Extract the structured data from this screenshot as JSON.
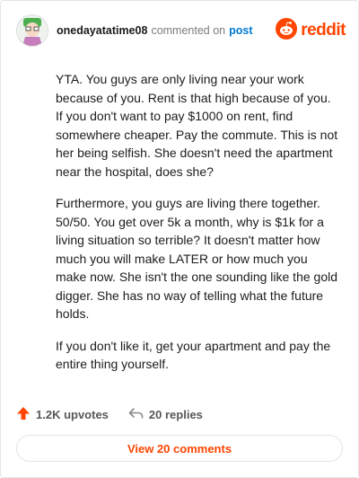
{
  "header": {
    "username": "onedayatatime08",
    "action_text": "commented on",
    "post_link": "post",
    "logo_text": "reddit"
  },
  "comment": {
    "paragraphs": [
      "YTA. You guys are only living near your work because of you. Rent is that high because of you. If you don't want to pay $1000 on rent, find somewhere cheaper. Pay the commute. This is not her being selfish. She doesn't need the apartment near the hospital, does she?",
      "Furthermore, you guys are living there together. 50/50. You get over 5k a month, why is $1k for a living situation so terrible? It doesn't matter how much you will make LATER or how much you make now. She isn't the one sounding like the gold digger. She has no way of telling what the future holds.",
      "If you don't like it, get your apartment and pay the entire thing yourself."
    ]
  },
  "footer": {
    "upvotes": "1.2K upvotes",
    "replies": "20 replies",
    "view_button": "View 20 comments"
  },
  "icons": {
    "avatar": "avatar-icon",
    "logo": "reddit-snoo-icon",
    "upvote": "upvote-arrow-icon",
    "reply": "reply-arrow-icon"
  },
  "colors": {
    "brand": "#ff4500",
    "link": "#0079d3",
    "muted": "#7c7c7c"
  }
}
